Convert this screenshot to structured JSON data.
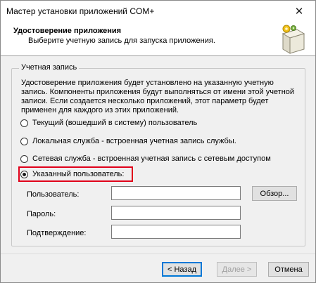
{
  "window": {
    "title": "Мастер установки приложений COM+",
    "close_glyph": "✕"
  },
  "header": {
    "title": "Удостоверение приложения",
    "subtitle": "Выберите учетную запись для запуска приложения.",
    "icon": "package-box-icon"
  },
  "account": {
    "group_label": "Учетная запись",
    "description": "Удостоверение приложения будет установлено на указанную учетную запись. Компоненты приложения будут выполняться от имени этой учетной записи. Если создается несколько приложений, этот параметр будет применен для каждого из этих приложений.",
    "options": [
      {
        "label": "Текущий (вошедший в систему) пользователь",
        "checked": false
      },
      {
        "label": "Локальная служба - встроенная учетная запись службы.",
        "checked": false
      },
      {
        "label": "Сетевая служба - встроенная учетная запись с сетевым доступом",
        "checked": false
      },
      {
        "label": "Указанный пользователь:",
        "checked": true
      }
    ],
    "highlight_color": "#e0001a"
  },
  "fields": {
    "user_label": "Пользователь:",
    "user_value": "",
    "browse_label": "Обзор...",
    "password_label": "Пароль:",
    "password_value": "",
    "confirm_label": "Подтверждение:",
    "confirm_value": ""
  },
  "footer": {
    "back_label": "< Назад",
    "next_label": "Далее >",
    "cancel_label": "Отмена"
  }
}
